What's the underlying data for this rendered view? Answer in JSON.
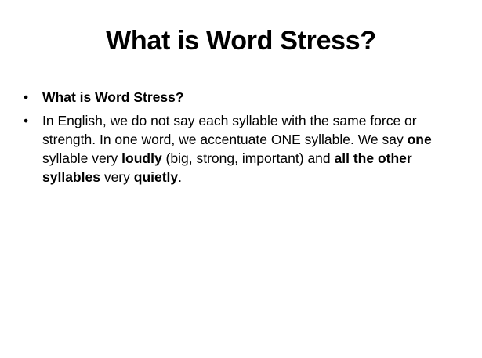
{
  "slide": {
    "title": "What is Word Stress?",
    "bullet_symbol": "•",
    "bullets": [
      {
        "segments": [
          {
            "text": "What is Word Stress?",
            "bold": true
          }
        ]
      },
      {
        "segments": [
          {
            "text": "In English, we do not say each syllable with the same force or strength. In one word, we accentuate ONE syllable. We say ",
            "bold": false
          },
          {
            "text": "one",
            "bold": true
          },
          {
            "text": " syllable very ",
            "bold": false
          },
          {
            "text": "loudly",
            "bold": true
          },
          {
            "text": " (big, strong, important) and ",
            "bold": false
          },
          {
            "text": "all the other syllables",
            "bold": true
          },
          {
            "text": " very ",
            "bold": false
          },
          {
            "text": "quietly",
            "bold": true
          },
          {
            "text": ".",
            "bold": false
          }
        ]
      }
    ]
  }
}
